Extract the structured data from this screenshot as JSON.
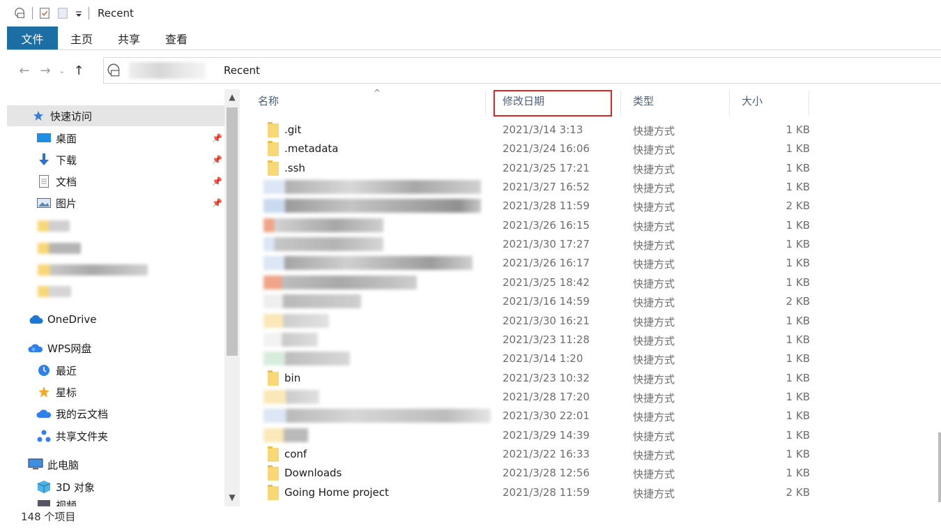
{
  "titlebar": {
    "title": "Recent"
  },
  "ribbon": {
    "tabs": [
      "文件",
      "主页",
      "共享",
      "查看"
    ]
  },
  "address": {
    "path": "Recent"
  },
  "nav": {
    "quick_access": "快速访问",
    "desktop": "桌面",
    "downloads": "下载",
    "documents": "文档",
    "pictures": "图片",
    "onedrive": "OneDrive",
    "wps": "WPS网盘",
    "recent": "最近",
    "starred": "星标",
    "my_cloud_docs": "我的云文档",
    "shared_folder": "共享文件夹",
    "this_pc": "此电脑",
    "objects_3d": "3D 对象",
    "video_partial": "视频"
  },
  "columns": {
    "name": "名称",
    "date": "修改日期",
    "type": "类型",
    "size": "大小"
  },
  "rows": [
    {
      "name": ".git",
      "date": "2021/3/14 3:13",
      "type": "快捷方式",
      "size": "1 KB"
    },
    {
      "name": ".metadata",
      "date": "2021/3/24 16:06",
      "type": "快捷方式",
      "size": "1 KB"
    },
    {
      "name": ".ssh",
      "date": "2021/3/25 17:21",
      "type": "快捷方式",
      "size": "1 KB"
    },
    {
      "name": "",
      "date": "2021/3/27 16:52",
      "type": "快捷方式",
      "size": "1 KB"
    },
    {
      "name": "",
      "date": "2021/3/28 11:59",
      "type": "快捷方式",
      "size": "2 KB"
    },
    {
      "name": "",
      "date": "2021/3/26 16:15",
      "type": "快捷方式",
      "size": "1 KB"
    },
    {
      "name": "",
      "date": "2021/3/30 17:27",
      "type": "快捷方式",
      "size": "1 KB"
    },
    {
      "name": "",
      "date": "2021/3/26 16:17",
      "type": "快捷方式",
      "size": "1 KB"
    },
    {
      "name": "",
      "date": "2021/3/25 18:42",
      "type": "快捷方式",
      "size": "1 KB"
    },
    {
      "name": "",
      "date": "2021/3/16 14:59",
      "type": "快捷方式",
      "size": "2 KB"
    },
    {
      "name": "",
      "date": "2021/3/30 16:21",
      "type": "快捷方式",
      "size": "1 KB"
    },
    {
      "name": "",
      "date": "2021/3/23 11:28",
      "type": "快捷方式",
      "size": "1 KB"
    },
    {
      "name": "",
      "date": "2021/3/14 1:20",
      "type": "快捷方式",
      "size": "1 KB"
    },
    {
      "name": "bin",
      "date": "2021/3/23 10:32",
      "type": "快捷方式",
      "size": "1 KB"
    },
    {
      "name": "",
      "date": "2021/3/28 17:20",
      "type": "快捷方式",
      "size": "1 KB"
    },
    {
      "name": "",
      "date": "2021/3/30 22:01",
      "type": "快捷方式",
      "size": "1 KB"
    },
    {
      "name": "",
      "date": "2021/3/29 14:39",
      "type": "快捷方式",
      "size": "1 KB"
    },
    {
      "name": "conf",
      "date": "2021/3/22 16:33",
      "type": "快捷方式",
      "size": "1 KB"
    },
    {
      "name": "Downloads",
      "date": "2021/3/28 12:56",
      "type": "快捷方式",
      "size": "1 KB"
    },
    {
      "name": "Going Home project",
      "date": "2021/3/28 11:59",
      "type": "快捷方式",
      "size": "2 KB"
    }
  ],
  "status": {
    "count": "148 个项目"
  },
  "colors": {
    "file_tab": "#1c6ea4",
    "highlight": "#e0241f",
    "folder": "#f8d775",
    "column_header": "#4c607a"
  }
}
